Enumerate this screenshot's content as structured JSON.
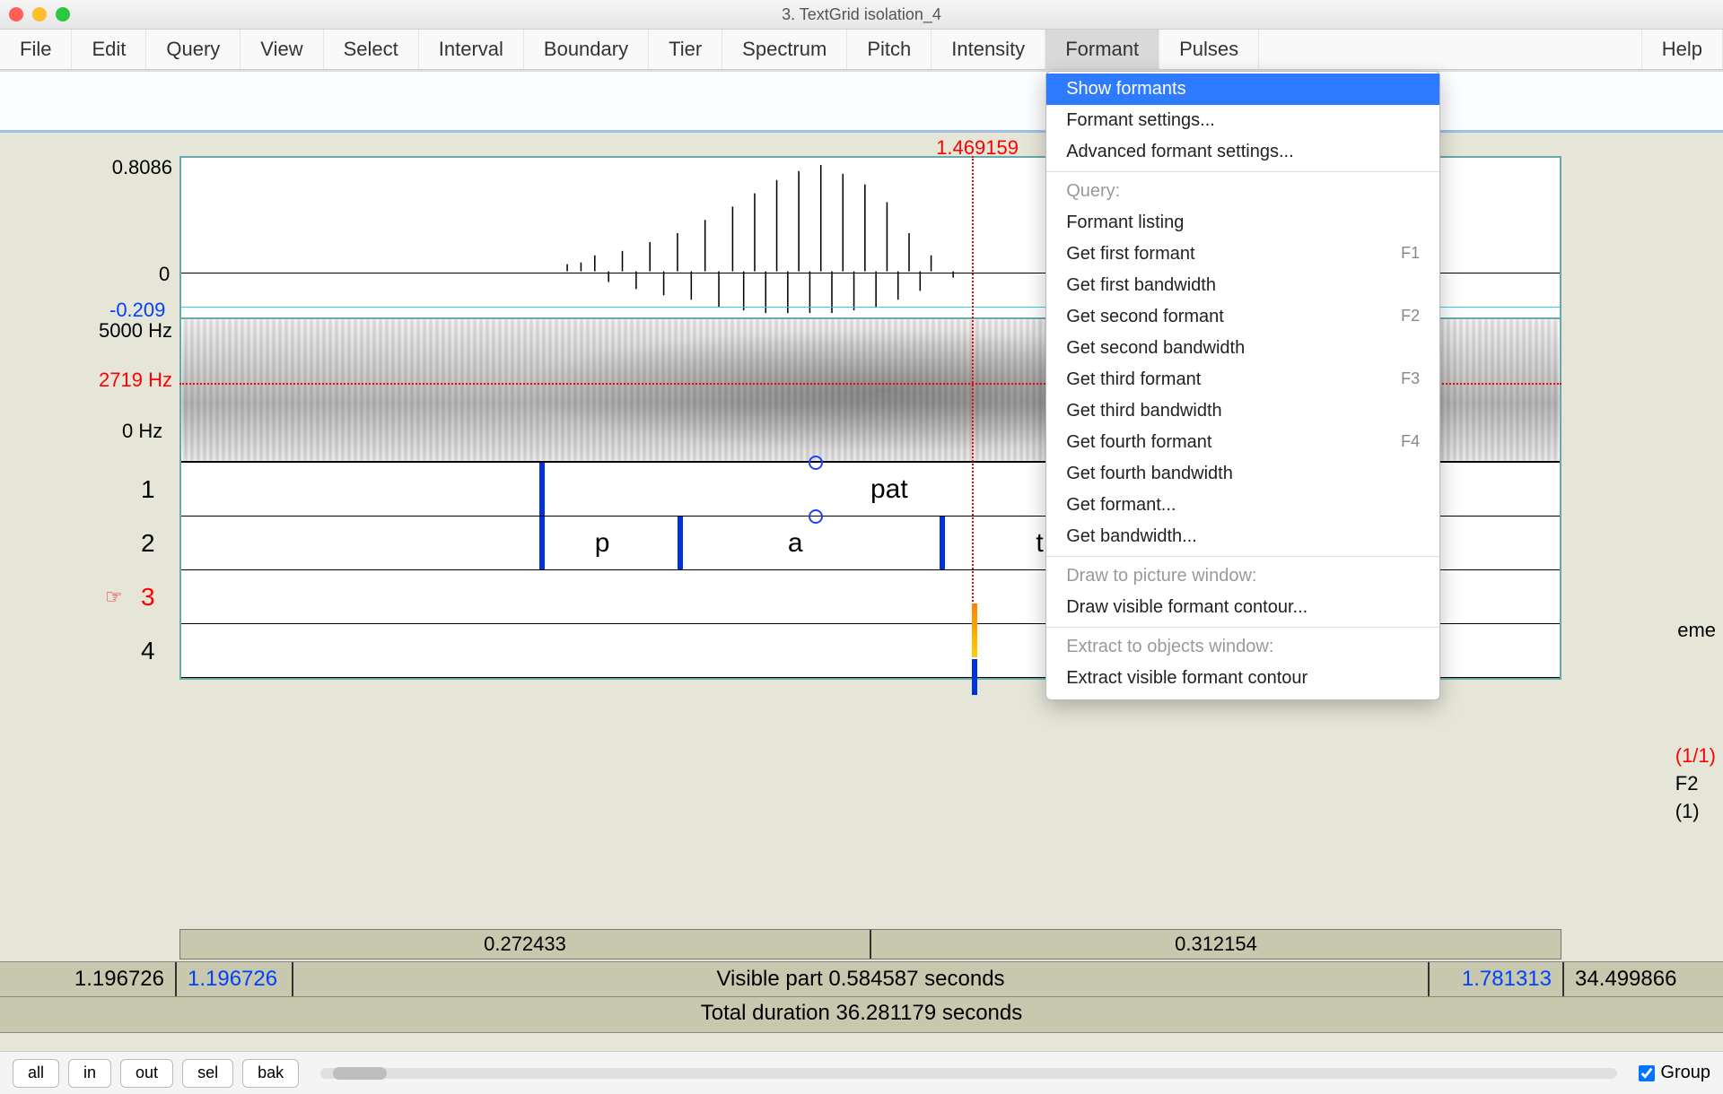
{
  "window": {
    "title": "3. TextGrid isolation_4"
  },
  "menu": {
    "items": [
      "File",
      "Edit",
      "Query",
      "View",
      "Select",
      "Interval",
      "Boundary",
      "Tier",
      "Spectrum",
      "Pitch",
      "Intensity",
      "Formant",
      "Pulses"
    ],
    "help": "Help",
    "open_index": 11
  },
  "formant_menu": {
    "show": "Show formants",
    "settings": "Formant settings...",
    "advanced": "Advanced formant settings...",
    "query_header": "Query:",
    "listing": "Formant listing",
    "get_first_formant": "Get first formant",
    "get_first_bw": "Get first bandwidth",
    "get_second_formant": "Get second formant",
    "get_second_bw": "Get second bandwidth",
    "get_third_formant": "Get third formant",
    "get_third_bw": "Get third bandwidth",
    "get_fourth_formant": "Get fourth formant",
    "get_fourth_bw": "Get fourth bandwidth",
    "get_formant": "Get formant...",
    "get_bandwidth": "Get bandwidth...",
    "draw_header": "Draw to picture window:",
    "draw_visible": "Draw visible formant contour...",
    "extract_header": "Extract to objects window:",
    "extract_visible": "Extract visible formant contour",
    "shortcuts": {
      "f1": "F1",
      "f2": "F2",
      "f3": "F3",
      "f4": "F4"
    }
  },
  "cursor": {
    "time": "1.469159",
    "formant_hz": "2719 Hz"
  },
  "waveform": {
    "max": "0.8086",
    "zero": "0",
    "min": "-0.209"
  },
  "spectrogram": {
    "max": "5000 Hz",
    "min": "0 Hz"
  },
  "tiers": {
    "t1": {
      "num": "1",
      "label": "pat"
    },
    "t2": {
      "num": "2",
      "segs": {
        "p": "p",
        "a": "a",
        "t": "t"
      }
    },
    "t3": {
      "num": "3"
    },
    "t4": {
      "num": "4"
    }
  },
  "times": {
    "left_dur": "0.272433",
    "right_dur": "0.312154"
  },
  "visible": {
    "left_pad": "1.196726",
    "start": "1.196726",
    "label": "Visible part 0.584587 seconds",
    "end": "1.781313",
    "right_pad": "34.499866"
  },
  "total": "Total duration 36.281179 seconds",
  "right_labels": {
    "eme": "eme",
    "frac": "(1/1)",
    "F2": "F2",
    "one": "(1)"
  },
  "footer": {
    "buttons": {
      "all": "all",
      "in": "in",
      "out": "out",
      "sel": "sel",
      "bak": "bak"
    },
    "group": "Group",
    "group_checked": true
  }
}
